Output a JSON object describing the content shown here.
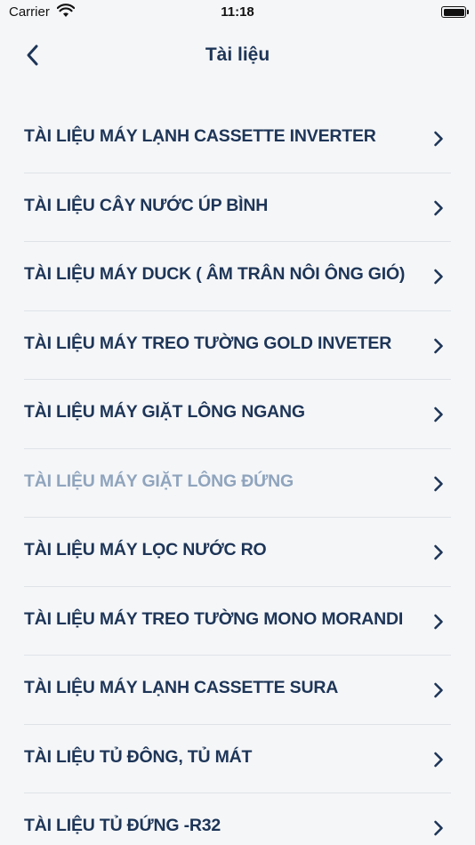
{
  "status_bar": {
    "carrier": "Carrier",
    "time": "11:18"
  },
  "nav": {
    "title": "Tài liệu",
    "back_icon": "chevron-left-icon"
  },
  "items": [
    {
      "label": "TÀI LIỆU MÁY LẠNH CASSETTE INVERTER",
      "dimmed": false
    },
    {
      "label": "TÀI LIỆU CÂY NƯỚC ÚP BÌNH",
      "dimmed": false
    },
    {
      "label": "TÀI LIỆU MÁY DUCK ( ÂM TRÂN NÔI ÔNG GIÓ)",
      "dimmed": false
    },
    {
      "label": "TÀI LIỆU MÁY TREO TƯỜNG GOLD INVETER",
      "dimmed": false
    },
    {
      "label": "TÀI LIỆU MÁY GIẶT LÔNG NGANG",
      "dimmed": false
    },
    {
      "label": "TÀI LIỆU MÁY GIẶT LÔNG ĐỨNG",
      "dimmed": true
    },
    {
      "label": "TÀI LIỆU MÁY LỌC NƯỚC RO",
      "dimmed": false
    },
    {
      "label": "TÀI LIỆU MÁY TREO TƯỜNG MONO MORANDI",
      "dimmed": false
    },
    {
      "label": "TÀI LIỆU MÁY LẠNH CASSETTE SURA",
      "dimmed": false
    },
    {
      "label": "TÀI LIỆU TỦ ĐÔNG, TỦ MÁT",
      "dimmed": false
    },
    {
      "label": "TÀI LIỆU TỦ ĐỨNG -R32",
      "dimmed": false
    }
  ],
  "colors": {
    "background": "#f5f6f8",
    "text": "#1d3557",
    "dimmed_text": "#8fa4bd",
    "divider": "#dfe3e8"
  }
}
